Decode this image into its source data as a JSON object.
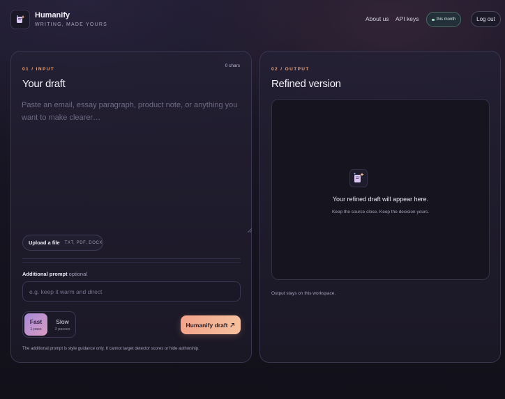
{
  "brand": {
    "name": "Humanify",
    "tagline": "WRITING, MADE YOURS",
    "logo_icon": "sparkle-doc-icon"
  },
  "nav": {
    "about": "About us",
    "api_keys": "API keys",
    "usage_label": "this month",
    "logout": "Log out"
  },
  "input_panel": {
    "eyebrow": "01 / INPUT",
    "title": "Your draft",
    "char_count": "0 chars",
    "draft_value": "",
    "draft_placeholder": "Paste an email, essay paragraph, product note, or anything you want to make clearer…",
    "upload": {
      "label": "Upload a file",
      "formats": "TXT, PDF, DOCX"
    },
    "additional_prompt": {
      "label": "Additional prompt",
      "optional": "optional",
      "value": "",
      "placeholder": "e.g. keep it warm and direct"
    },
    "modes": [
      {
        "name": "Fast",
        "detail": "1 pass",
        "selected": true
      },
      {
        "name": "Slow",
        "detail": "3 passes",
        "selected": false
      }
    ],
    "submit_label": "Humanify draft",
    "submit_icon": "arrow-up-right-icon",
    "disclaimer": "The additional prompt is style guidance only. It cannot target detector scores or hide authorship."
  },
  "output_panel": {
    "eyebrow": "02 / OUTPUT",
    "title": "Refined version",
    "empty_title": "Your refined draft will appear here.",
    "empty_sub": "Keep the source close. Keep the decision yours.",
    "footer": "Output stays on this workspace."
  },
  "colors": {
    "accent": "#f2a48b",
    "eyebrow": "#e9a27a",
    "fast_mode_start": "#a68ad8",
    "fast_mode_end": "#d99bc2"
  }
}
